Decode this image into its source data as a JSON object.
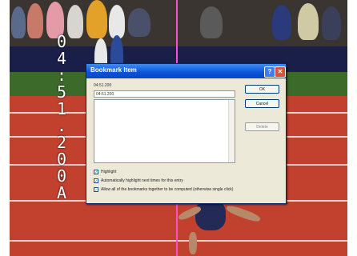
{
  "timer_chars": [
    "0",
    "4",
    ":",
    "5",
    "1",
    ".",
    "2",
    "0",
    "0",
    "A"
  ],
  "dialog": {
    "title": "Bookmark Item",
    "name_label": "04:51.200",
    "name_value": "04:51.200",
    "ok_label": "OK",
    "cancel_label": "Cancel",
    "delete_label": "Delete",
    "checkboxes": [
      {
        "label": "Highlight",
        "checked": true
      },
      {
        "label": "Automatically highlight next times for this entry",
        "checked": true
      },
      {
        "label": "Allow all of the bookmarks together to be computed (otherwise single click)",
        "checked": true
      }
    ]
  },
  "colors": {
    "finish_line": "#ff4fd0",
    "track": "#c2402e",
    "titlebar": "#0a52d6"
  }
}
